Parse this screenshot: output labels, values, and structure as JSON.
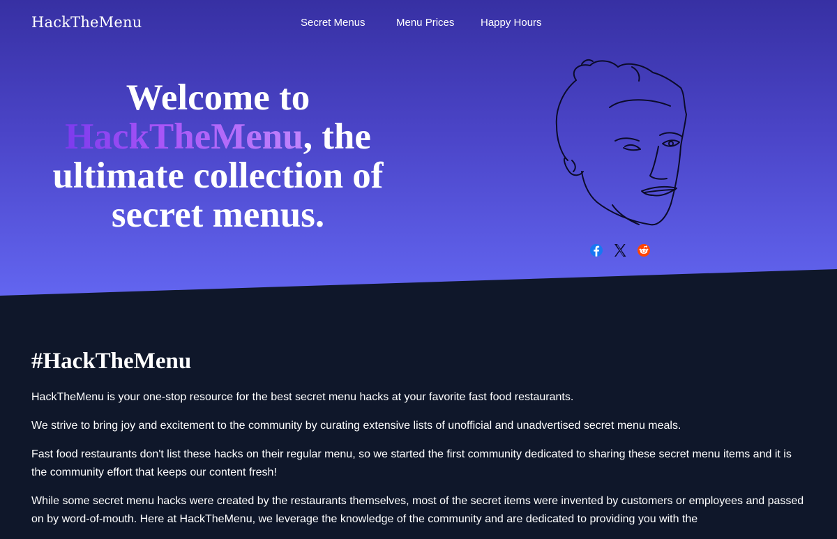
{
  "nav": {
    "brand": "HackTheMenu",
    "links": [
      "Secret Menus",
      "Menu Prices",
      "Happy Hours"
    ]
  },
  "hero": {
    "headline_prefix": "Welcome to",
    "headline_brand": "HackTheMenu",
    "headline_suffix": ", the ultimate collection of secret menus."
  },
  "share": {
    "icons": [
      "facebook-icon",
      "x-icon",
      "reddit-icon"
    ]
  },
  "content": {
    "heading": "#HackTheMenu",
    "paragraphs": [
      "HackTheMenu is your one-stop resource for the best secret menu hacks at your favorite fast food restaurants.",
      "We strive to bring joy and excitement to the community by curating extensive lists of unofficial and unadvertised secret menu meals.",
      "Fast food restaurants don't list these hacks on their regular menu, so we started the first community dedicated to sharing these secret menu items and it is the community effort that keeps our content fresh!",
      "While some secret menu hacks were created by the restaurants themselves, most of the secret items were invented by customers or employees and passed on by word-of-mouth. Here at HackTheMenu, we leverage the knowledge of the community and are dedicated to providing you with the"
    ]
  },
  "colors": {
    "hero_top": "#3730a3",
    "hero_bottom": "#6366f1",
    "page_bg": "#0f172a",
    "brand_gradient_start": "#7c3aed",
    "brand_gradient_end": "#c084fc",
    "facebook": "#1877f2",
    "reddit": "#ff4500"
  }
}
